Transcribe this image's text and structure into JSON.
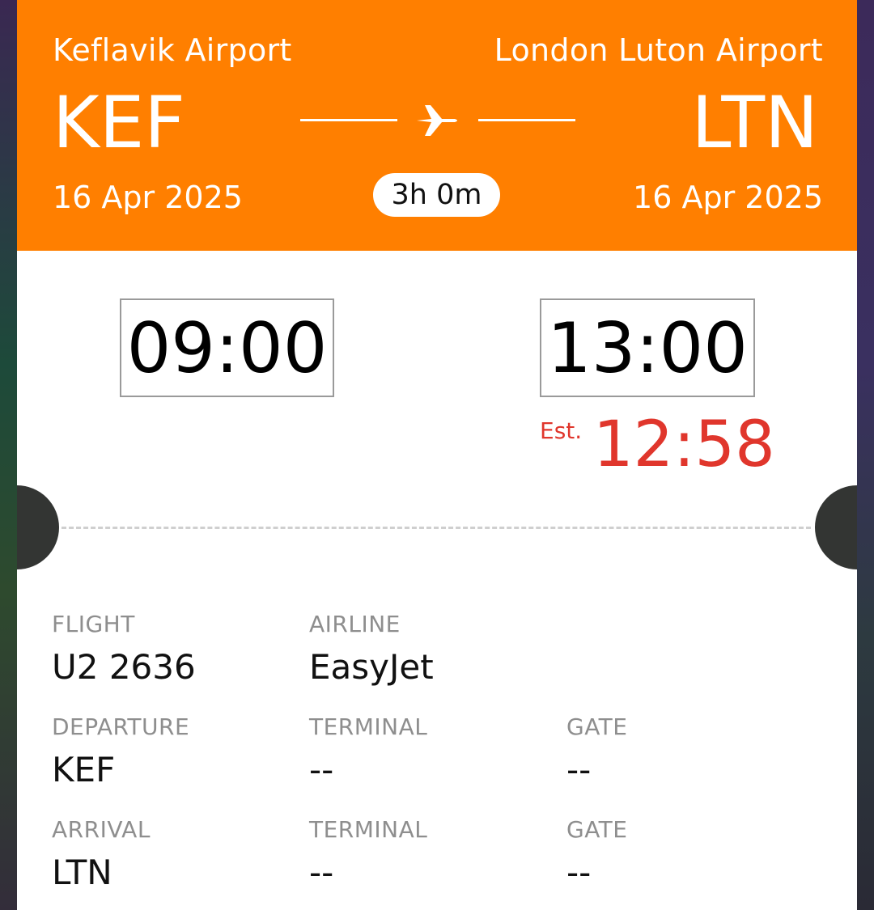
{
  "header": {
    "departure_airport": "Keflavik Airport",
    "arrival_airport": "London Luton Airport",
    "departure_code": "KEF",
    "arrival_code": "LTN",
    "departure_date": "16 Apr 2025",
    "arrival_date": "16 Apr 2025",
    "duration": "3h 0m",
    "icon": "airplane-icon",
    "accent_color": "#ff7f00"
  },
  "times": {
    "departure_time": "09:00",
    "arrival_time": "13:00",
    "estimated_label": "Est.",
    "estimated_arrival": "12:58",
    "estimated_color": "#e0362c"
  },
  "details": {
    "flight_label": "FLIGHT",
    "flight_value": "U2 2636",
    "airline_label": "AIRLINE",
    "airline_value": "EasyJet",
    "departure_label": "DEPARTURE",
    "departure_value": "KEF",
    "dep_terminal_label": "TERMINAL",
    "dep_terminal_value": "--",
    "dep_gate_label": "GATE",
    "dep_gate_value": "--",
    "arrival_label": "ARRIVAL",
    "arrival_value": "LTN",
    "arr_terminal_label": "TERMINAL",
    "arr_terminal_value": "--",
    "arr_gate_label": "GATE",
    "arr_gate_value": "--"
  }
}
